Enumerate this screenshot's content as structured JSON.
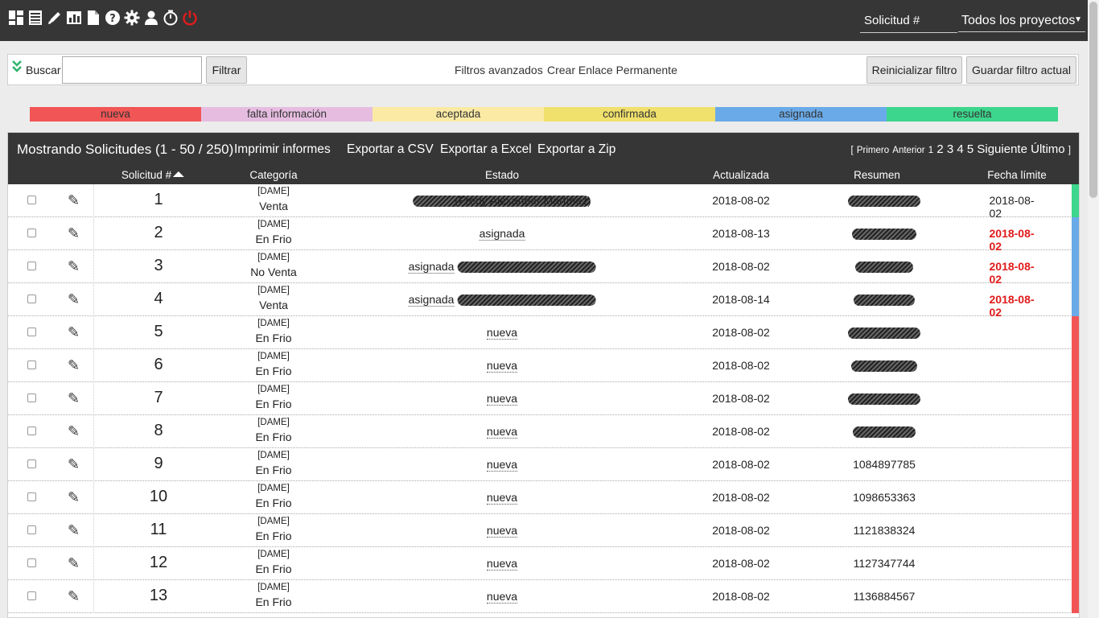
{
  "topbar": {
    "icons": [
      "dashboard-icon",
      "list-icon",
      "pencil-icon",
      "chart-icon",
      "document-icon",
      "help-icon",
      "gear-icon",
      "user-icon",
      "timer-icon",
      "power-icon"
    ],
    "search_placeholder": "Solicitud #",
    "project_selector": "Todos los proyectos"
  },
  "filter": {
    "search_label": "Buscar",
    "search_value": "",
    "filter_button": "Filtrar",
    "advanced_filters": "Filtros avanzados",
    "permalink": "Crear Enlace Permanente",
    "reset_button": "Reinicializar filtro",
    "save_button": "Guardar filtro actual"
  },
  "legend": [
    {
      "label": "nueva",
      "color": "#f25555"
    },
    {
      "label": "falta información",
      "color": "#e6bde0"
    },
    {
      "label": "aceptada",
      "color": "#faeaa4"
    },
    {
      "label": "confirmada",
      "color": "#f0e06c"
    },
    {
      "label": "asignada",
      "color": "#6aaae8"
    },
    {
      "label": "resuelta",
      "color": "#3cd68c"
    }
  ],
  "panel": {
    "title": "Mostrando Solicitudes (1 - 50 / 250)",
    "actions": [
      "Imprimir informes",
      "Exportar a CSV",
      "Exportar a Excel",
      "Exportar a Zip"
    ],
    "pager": {
      "open_bracket": "[",
      "first": "Primero",
      "prev": "Anterior",
      "pages": [
        "1",
        "2",
        "3",
        "4",
        "5"
      ],
      "next": "Siguiente",
      "last": "Último",
      "close_bracket": "]"
    },
    "columns": [
      "Solicitud #",
      "Categoría",
      "Estado",
      "Actualizada",
      "Resumen",
      "Fecha límite"
    ]
  },
  "rows": [
    {
      "id": "1",
      "project": "[DAME]",
      "category": "Venta",
      "status": "(Fredy Alexander Martínez)",
      "status_redacted": true,
      "updated": "2018-08-02",
      "summary": "",
      "summary_redacted": true,
      "due": "2018-08-02",
      "due_overdue": false,
      "color": "#3cd68c"
    },
    {
      "id": "2",
      "project": "[DAME]",
      "category": "En Frio",
      "status": "asignada",
      "status_redacted": false,
      "updated": "2018-08-13",
      "summary": "",
      "summary_redacted": true,
      "due": "2018-08-02",
      "due_overdue": true,
      "color": "#6aaae8"
    },
    {
      "id": "3",
      "project": "[DAME]",
      "category": "No Venta",
      "status": "asignada",
      "status_redacted": true,
      "updated": "2018-08-02",
      "summary": "",
      "summary_redacted": true,
      "due": "2018-08-02",
      "due_overdue": true,
      "color": "#6aaae8"
    },
    {
      "id": "4",
      "project": "[DAME]",
      "category": "Venta",
      "status": "asignada",
      "status_redacted": true,
      "updated": "2018-08-14",
      "summary": "",
      "summary_redacted": true,
      "due": "2018-08-02",
      "due_overdue": true,
      "color": "#6aaae8"
    },
    {
      "id": "5",
      "project": "[DAME]",
      "category": "En Frio",
      "status": "nueva",
      "status_redacted": false,
      "updated": "2018-08-02",
      "summary": "",
      "summary_redacted": true,
      "due": "",
      "due_overdue": false,
      "color": "#f25555"
    },
    {
      "id": "6",
      "project": "[DAME]",
      "category": "En Frio",
      "status": "nueva",
      "status_redacted": false,
      "updated": "2018-08-02",
      "summary": "",
      "summary_redacted": true,
      "due": "",
      "due_overdue": false,
      "color": "#f25555"
    },
    {
      "id": "7",
      "project": "[DAME]",
      "category": "En Frio",
      "status": "nueva",
      "status_redacted": false,
      "updated": "2018-08-02",
      "summary": "",
      "summary_redacted": true,
      "due": "",
      "due_overdue": false,
      "color": "#f25555"
    },
    {
      "id": "8",
      "project": "[DAME]",
      "category": "En Frio",
      "status": "nueva",
      "status_redacted": false,
      "updated": "2018-08-02",
      "summary": "",
      "summary_redacted": true,
      "due": "",
      "due_overdue": false,
      "color": "#f25555"
    },
    {
      "id": "9",
      "project": "[DAME]",
      "category": "En Frio",
      "status": "nueva",
      "status_redacted": false,
      "updated": "2018-08-02",
      "summary": "1084897785",
      "summary_redacted": false,
      "due": "",
      "due_overdue": false,
      "color": "#f25555"
    },
    {
      "id": "10",
      "project": "[DAME]",
      "category": "En Frio",
      "status": "nueva",
      "status_redacted": false,
      "updated": "2018-08-02",
      "summary": "1098653363",
      "summary_redacted": false,
      "due": "",
      "due_overdue": false,
      "color": "#f25555"
    },
    {
      "id": "11",
      "project": "[DAME]",
      "category": "En Frio",
      "status": "nueva",
      "status_redacted": false,
      "updated": "2018-08-02",
      "summary": "1121838324",
      "summary_redacted": false,
      "due": "",
      "due_overdue": false,
      "color": "#f25555"
    },
    {
      "id": "12",
      "project": "[DAME]",
      "category": "En Frio",
      "status": "nueva",
      "status_redacted": false,
      "updated": "2018-08-02",
      "summary": "1127347744",
      "summary_redacted": false,
      "due": "",
      "due_overdue": false,
      "color": "#f25555"
    },
    {
      "id": "13",
      "project": "[DAME]",
      "category": "En Frio",
      "status": "nueva",
      "status_redacted": false,
      "updated": "2018-08-02",
      "summary": "1136884567",
      "summary_redacted": false,
      "due": "",
      "due_overdue": false,
      "color": "#f25555"
    }
  ]
}
